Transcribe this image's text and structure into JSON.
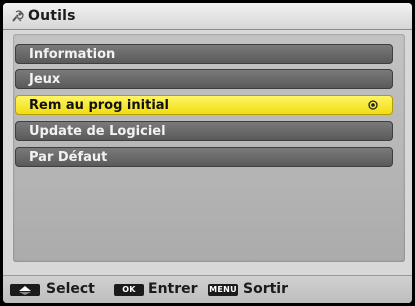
{
  "window": {
    "title": "Outils",
    "title_icon": "tools-icon"
  },
  "menu": {
    "items": [
      {
        "label": "Information",
        "selected": false
      },
      {
        "label": "Jeux",
        "selected": false
      },
      {
        "label": "Rem au prog initial",
        "selected": true
      },
      {
        "label": "Update de Logiciel",
        "selected": false
      },
      {
        "label": "Par Défaut",
        "selected": false
      }
    ],
    "selected_indicator_icon": "radio-selected-icon"
  },
  "footer": {
    "hints": [
      {
        "key_icon": "up-down-arrows-icon",
        "key_text": "",
        "label": "Select"
      },
      {
        "key_icon": "ok-key-icon",
        "key_text": "OK",
        "label": "Entrer"
      },
      {
        "key_icon": "menu-key-icon",
        "key_text": "MENU",
        "label": "Sortir"
      }
    ]
  },
  "colors": {
    "highlight": "#f5e52a",
    "item_bg": "#6a6a6a",
    "panel_bg": "#d8d8d8"
  }
}
